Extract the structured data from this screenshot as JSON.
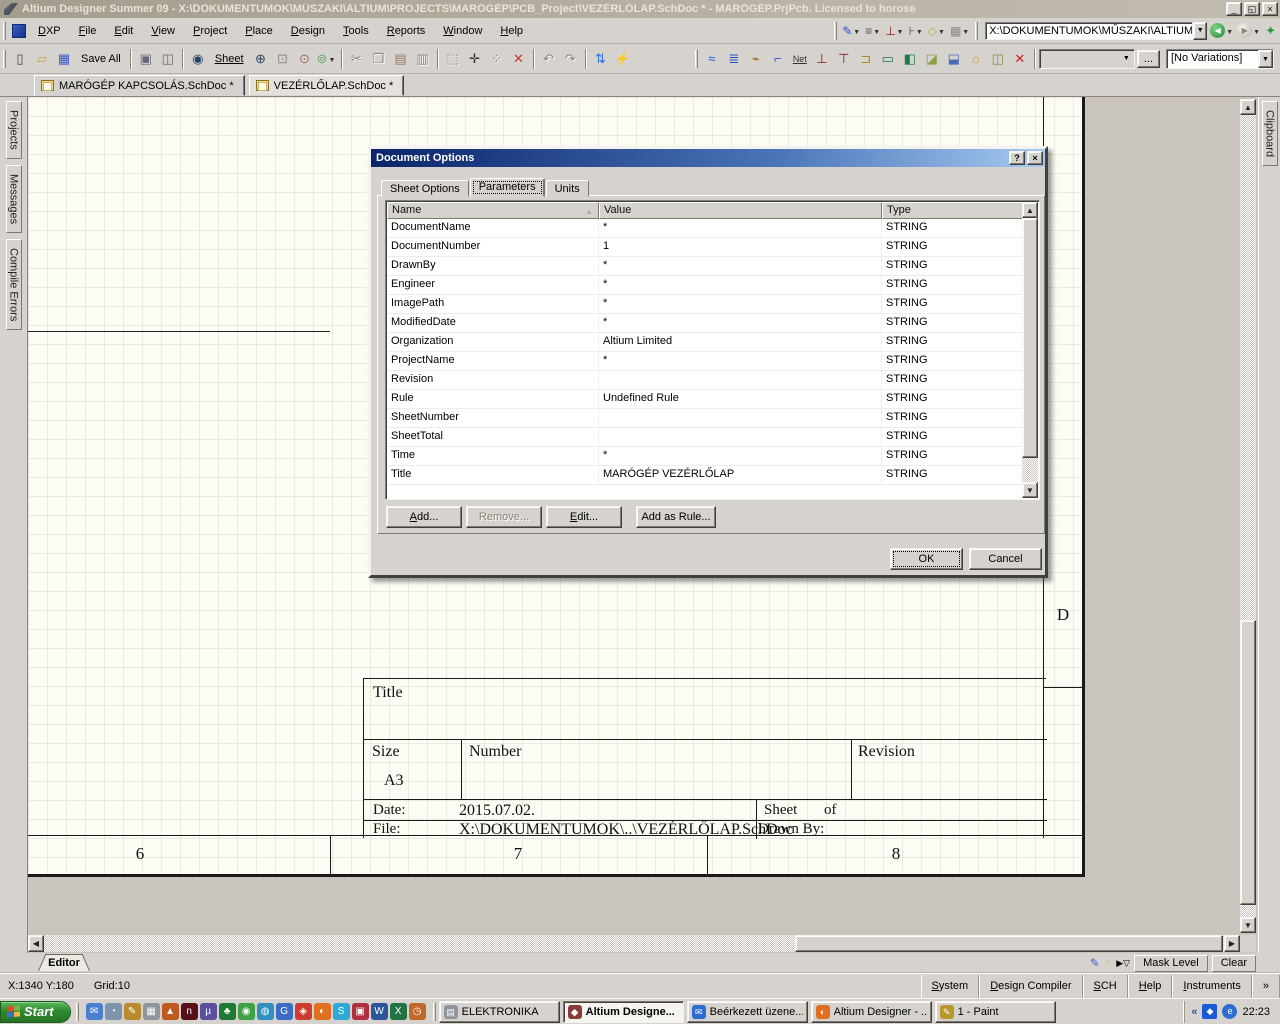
{
  "titlebar": {
    "title": "Altium Designer Summer 09 - X:\\DOKUMENTUMOK\\MŰSZAKI\\ALTIUM\\PROJECTS\\MARÓGÉP\\PCB_Project\\VEZÉRLŐLAP.SchDoc * - MARÓGÉP.PrjPcb. Licensed to horose",
    "controls": {
      "minimize": "_",
      "restore": "◱",
      "close": "×"
    }
  },
  "menu": {
    "items": [
      "DXP",
      "File",
      "Edit",
      "View",
      "Project",
      "Place",
      "Design",
      "Tools",
      "Reports",
      "Window",
      "Help"
    ]
  },
  "address_bar": {
    "value": "X:\\DOKUMENTUMOK\\MŰSZAKI\\ALTIUM",
    "dropdown": "▼"
  },
  "toolbar": {
    "save_all": "Save All",
    "sheet": "Sheet",
    "more": "...",
    "variations": "[No Variations]"
  },
  "doc_tabs": [
    "MARÓGÉP KAPCSOLÁS.SchDoc *",
    "VEZÉRLŐLAP.SchDoc *"
  ],
  "side_panels": {
    "left": [
      "Projects",
      "Messages",
      "Compile Errors"
    ],
    "right": [
      "Clipboard"
    ]
  },
  "dialog": {
    "title": "Document Options",
    "help_glyph": "?",
    "close_glyph": "×",
    "tabs": [
      "Sheet Options",
      "Parameters",
      "Units"
    ],
    "active_tab": "Parameters",
    "table": {
      "columns": [
        "Name",
        "Value",
        "Type"
      ],
      "rows": [
        {
          "name": "DocumentName",
          "value": "*",
          "type": "STRING"
        },
        {
          "name": "DocumentNumber",
          "value": "1",
          "type": "STRING"
        },
        {
          "name": "DrawnBy",
          "value": "*",
          "type": "STRING"
        },
        {
          "name": "Engineer",
          "value": "*",
          "type": "STRING"
        },
        {
          "name": "ImagePath",
          "value": "*",
          "type": "STRING"
        },
        {
          "name": "ModifiedDate",
          "value": "*",
          "type": "STRING"
        },
        {
          "name": "Organization",
          "value": "Altium Limited",
          "type": "STRING"
        },
        {
          "name": "ProjectName",
          "value": "*",
          "type": "STRING"
        },
        {
          "name": "Revision",
          "value": "",
          "type": "STRING"
        },
        {
          "name": "Rule",
          "value": "Undefined Rule",
          "type": "STRING"
        },
        {
          "name": "SheetNumber",
          "value": "",
          "type": "STRING"
        },
        {
          "name": "SheetTotal",
          "value": "",
          "type": "STRING"
        },
        {
          "name": "Time",
          "value": "*",
          "type": "STRING"
        },
        {
          "name": "Title",
          "value": "MARÓGÉP VEZÉRLŐLAP",
          "type": "STRING"
        }
      ]
    },
    "buttons": {
      "add": "Add...",
      "remove": "Remove...",
      "edit": "Edit...",
      "add_as_rule": "Add as Rule...",
      "ok": "OK",
      "cancel": "Cancel"
    }
  },
  "sheet": {
    "zone_letters": [
      "D"
    ],
    "zone_numbers": [
      "6",
      "7",
      "8"
    ],
    "title_block": {
      "title_label": "Title",
      "size_label": "Size",
      "size_value": "A3",
      "number_label": "Number",
      "revision_label": "Revision",
      "date_label": "Date:",
      "date_value": "2015.07.02.",
      "file_label": "File:",
      "file_value": "X:\\DOKUMENTUMOK\\..\\VEZÉRLŐLAP.SchDoc",
      "sheet_label": "Sheet",
      "of_label": "of",
      "drawn_by_label": "Drawn By:"
    }
  },
  "editor_bar": {
    "tab": "Editor",
    "mask_level": "Mask Level",
    "clear": "Clear"
  },
  "status_bar": {
    "coords": "X:1340 Y:180",
    "grid": "Grid:10",
    "panels": [
      "System",
      "Design Compiler",
      "SCH",
      "Help",
      "Instruments",
      "»"
    ]
  },
  "taskbar": {
    "start": "Start",
    "quick_launch": [
      {
        "name": "mail",
        "glyph": "✉",
        "color": "#4a7fd0"
      },
      {
        "name": "clock",
        "glyph": "◔",
        "color": "#7e93ad"
      },
      {
        "name": "paint",
        "glyph": "✎",
        "color": "#b98a2e"
      },
      {
        "name": "calculator",
        "glyph": "▦",
        "color": "#8f959d"
      },
      {
        "name": "orange-app",
        "glyph": "▲",
        "color": "#c05a20"
      },
      {
        "name": "n-app",
        "glyph": "n",
        "color": "#571019"
      },
      {
        "name": "utorrent",
        "glyph": "µ",
        "color": "#5b4fa0"
      },
      {
        "name": "palm",
        "glyph": "♣",
        "color": "#1f7a33"
      },
      {
        "name": "green-player",
        "glyph": "◉",
        "color": "#3fa045"
      },
      {
        "name": "earth",
        "glyph": "◍",
        "color": "#2f8fbf"
      },
      {
        "name": "g-browser",
        "glyph": "G",
        "color": "#3a6cc4"
      },
      {
        "name": "pinwheel",
        "glyph": "◈",
        "color": "#d03b2f"
      },
      {
        "name": "firefox",
        "glyph": "◐",
        "color": "#e07020"
      },
      {
        "name": "skype",
        "glyph": "S",
        "color": "#2ea8d5"
      },
      {
        "name": "floppy",
        "glyph": "▣",
        "color": "#b03040"
      },
      {
        "name": "word",
        "glyph": "W",
        "color": "#2b579a"
      },
      {
        "name": "excel",
        "glyph": "X",
        "color": "#217346"
      },
      {
        "name": "orange-clock",
        "glyph": "◷",
        "color": "#c06a28"
      }
    ],
    "tasks": [
      {
        "label": "ELEKTRONIKA",
        "active": false,
        "icon": "folder-window",
        "glyph": "▤",
        "color": "#8f959d"
      },
      {
        "label": "Altium Designe...",
        "active": true,
        "icon": "altium",
        "glyph": "◆",
        "color": "#8a3a3a"
      },
      {
        "label": "Beérkezett üzene...",
        "active": false,
        "icon": "mail",
        "glyph": "✉",
        "color": "#2f6cd0"
      },
      {
        "label": "Altium Designer - ...",
        "active": false,
        "icon": "firefox",
        "glyph": "◐",
        "color": "#e07020"
      },
      {
        "label": "1 - Paint",
        "active": false,
        "icon": "paint",
        "glyph": "✎",
        "color": "#b9952e"
      }
    ],
    "tray": {
      "chevron": "«",
      "clock": "22:23"
    }
  }
}
